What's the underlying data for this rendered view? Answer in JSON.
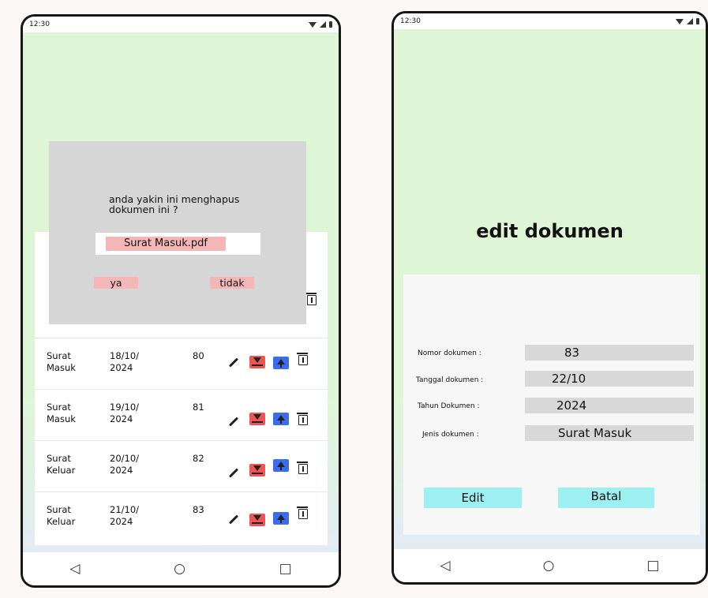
{
  "left_phone": {
    "status_time": "12:30",
    "rows": [
      {
        "jenis": [
          "Surat",
          "Masuk"
        ],
        "tanggal": [
          "18/10/",
          "2024"
        ],
        "nomor": "80"
      },
      {
        "jenis": [
          "Surat",
          "Masuk"
        ],
        "tanggal": [
          "19/10/",
          "2024"
        ],
        "nomor": "81"
      },
      {
        "jenis": [
          "Surat",
          "Keluar"
        ],
        "tanggal": [
          "20/10/",
          "2024"
        ],
        "nomor": "82"
      },
      {
        "jenis": [
          "Surat",
          "Keluar"
        ],
        "tanggal": [
          "21/10/",
          "2024"
        ],
        "nomor": "83"
      }
    ],
    "dialog": {
      "message": "anda yakin ini menghapus dokumen ini ?",
      "file_name": "Surat Masuk.pdf",
      "yes_label": "ya",
      "no_label": "tidak"
    },
    "nav": {
      "back": "◁",
      "home": "○",
      "recents": "□"
    }
  },
  "right_phone": {
    "status_time": "12:30",
    "title": "edit dokumen",
    "fields": {
      "nomor": {
        "label": "Nomor dokumen :",
        "value": "83"
      },
      "tanggal": {
        "label": "Tanggal dokumen :",
        "value": "22/10"
      },
      "tahun": {
        "label": "Tahun Dokumen :",
        "value": "2024"
      },
      "jenis": {
        "label": "Jenis dokumen :",
        "value": "Surat Masuk"
      }
    },
    "buttons": {
      "edit": "Edit",
      "cancel": "Batal"
    },
    "nav": {
      "back": "◁",
      "home": "○",
      "recents": "□"
    }
  },
  "colors": {
    "screen_green": "#dff6d6",
    "dialog_gray": "#d6d6d6",
    "pink_button": "#f4b6b6",
    "cyan_button": "#9cf0f2",
    "download_red": "#e55555",
    "upload_blue": "#3b6cf0"
  },
  "icons": [
    "pencil-icon",
    "download-icon",
    "upload-icon",
    "trash-icon",
    "wifi-icon",
    "signal-icon",
    "battery-icon"
  ]
}
